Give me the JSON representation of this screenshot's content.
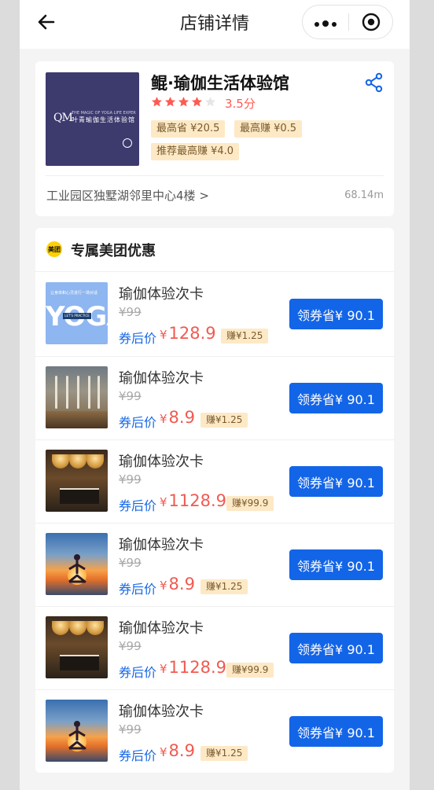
{
  "nav": {
    "title": "店铺详情"
  },
  "shop": {
    "name": "鲲·瑜伽生活体验馆",
    "rating": 3.5,
    "rating_text": "3.5分",
    "logo": {
      "mark": "QM",
      "tagline": "THE MAGIC OF YOGA LIFE EXPERIENCE",
      "cn": "叶青瑜伽生活体验馆"
    },
    "tags": [
      "最高省 ¥20.5",
      "最高赚 ¥0.5",
      "推荐最高赚 ¥4.0"
    ],
    "address": "工业园区独墅湖邻里中心4楼 >",
    "distance": "68.14m"
  },
  "coupons": {
    "badge": "美团",
    "title": "专属美团优惠",
    "after_label": "券后价",
    "items": [
      {
        "name": "瑜伽体验次卡",
        "orig": "¥99",
        "yen": "¥",
        "price": "128.9",
        "earn": "赚¥1.25",
        "button": "领券省¥ 90.1",
        "thumb": "yoga-poster"
      },
      {
        "name": "瑜伽体验次卡",
        "orig": "¥99",
        "yen": "¥",
        "price": "8.9",
        "earn": "赚¥1.25",
        "button": "领券省¥ 90.1",
        "thumb": "studio"
      },
      {
        "name": "瑜伽体验次卡",
        "orig": "¥99",
        "yen": "¥",
        "price": "1128.9",
        "earn": "赚¥99.9",
        "button": "领券省¥ 90.1",
        "thumb": "lobby"
      },
      {
        "name": "瑜伽体验次卡",
        "orig": "¥99",
        "yen": "¥",
        "price": "8.9",
        "earn": "赚¥1.25",
        "button": "领券省¥ 90.1",
        "thumb": "sunset"
      },
      {
        "name": "瑜伽体验次卡",
        "orig": "¥99",
        "yen": "¥",
        "price": "1128.9",
        "earn": "赚¥99.9",
        "button": "领券省¥ 90.1",
        "thumb": "lobby"
      },
      {
        "name": "瑜伽体验次卡",
        "orig": "¥99",
        "yen": "¥",
        "price": "8.9",
        "earn": "赚¥1.25",
        "button": "领券省¥ 90.1",
        "thumb": "sunset"
      }
    ],
    "yoga_poster": {
      "small": "让身体和心灵进行一场对话",
      "word": "YOGA",
      "bar": "LET'S PRACTICE"
    }
  },
  "colors": {
    "accent_blue": "#1365e8",
    "price_red": "#f15a50",
    "star": "#ff5a52",
    "tag_bg": "#fde9c6"
  }
}
